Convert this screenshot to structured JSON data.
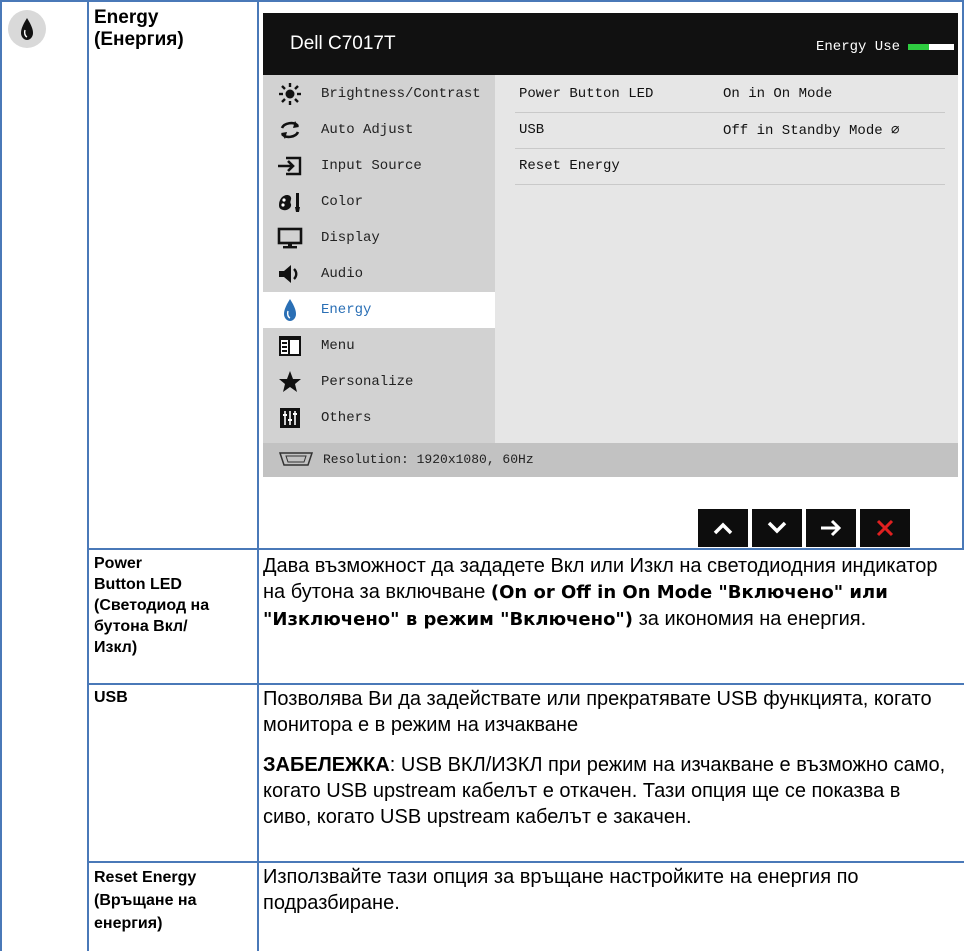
{
  "header": {
    "title": "Energy\n(Енергия)",
    "icon": "energy-drop-icon"
  },
  "osd": {
    "model": "Dell C7017T",
    "energy_use_label": "Energy Use",
    "energy_use_level": 0.45,
    "menu": [
      {
        "label": "Brightness/Contrast",
        "icon": "brightness-icon"
      },
      {
        "label": "Auto Adjust",
        "icon": "auto-adjust-icon"
      },
      {
        "label": "Input Source",
        "icon": "input-source-icon"
      },
      {
        "label": "Color",
        "icon": "color-icon"
      },
      {
        "label": "Display",
        "icon": "display-icon"
      },
      {
        "label": "Audio",
        "icon": "audio-icon"
      },
      {
        "label": "Energy",
        "icon": "energy-icon",
        "active": true
      },
      {
        "label": "Menu",
        "icon": "menu-icon"
      },
      {
        "label": "Personalize",
        "icon": "star-icon"
      },
      {
        "label": "Others",
        "icon": "others-icon"
      }
    ],
    "submenu": [
      {
        "label": "Power Button LED",
        "value": "On in On Mode"
      },
      {
        "label": "USB",
        "value": "Off in Standby Mode ∅"
      },
      {
        "label": "Reset Energy",
        "value": ""
      }
    ],
    "resolution": "Resolution: 1920x1080, 60Hz",
    "nav_buttons": [
      "up-arrow-icon",
      "down-arrow-icon",
      "right-arrow-icon",
      "close-icon"
    ]
  },
  "rows": [
    {
      "label": "Power\nButton LED\n(Светодиод на\nбутона Вкл/\nИзкл)",
      "desc_plain": "Дава възможност да зададете Вкл или Изкл на светодиодния индикатор на бутона за включване ",
      "desc_bold": "(On or Off in On Mode \"Включено\" или \"Изключено\" в режим \"Включено\")",
      "desc_tail": " за икономия на енергия."
    },
    {
      "label": "USB",
      "desc_plain": "Позволява Ви да задействате или прекратявате USB функцията, когато монитора е в режим на изчакване",
      "note_label": "ЗАБЕЛЕЖКА",
      "note_text": ": USB ВКЛ/ИЗКЛ при режим на изчакване е възможно само, когато USB upstream кабелът е откачен. Тази опция ще се показва в сиво, когато USB upstream кабелът е закачен."
    },
    {
      "label": "Reset Energy\n(Връщане на\nенергия)",
      "desc_plain": "Използвайте тази опция за връщане настройките на енергия по подразбиране."
    }
  ]
}
